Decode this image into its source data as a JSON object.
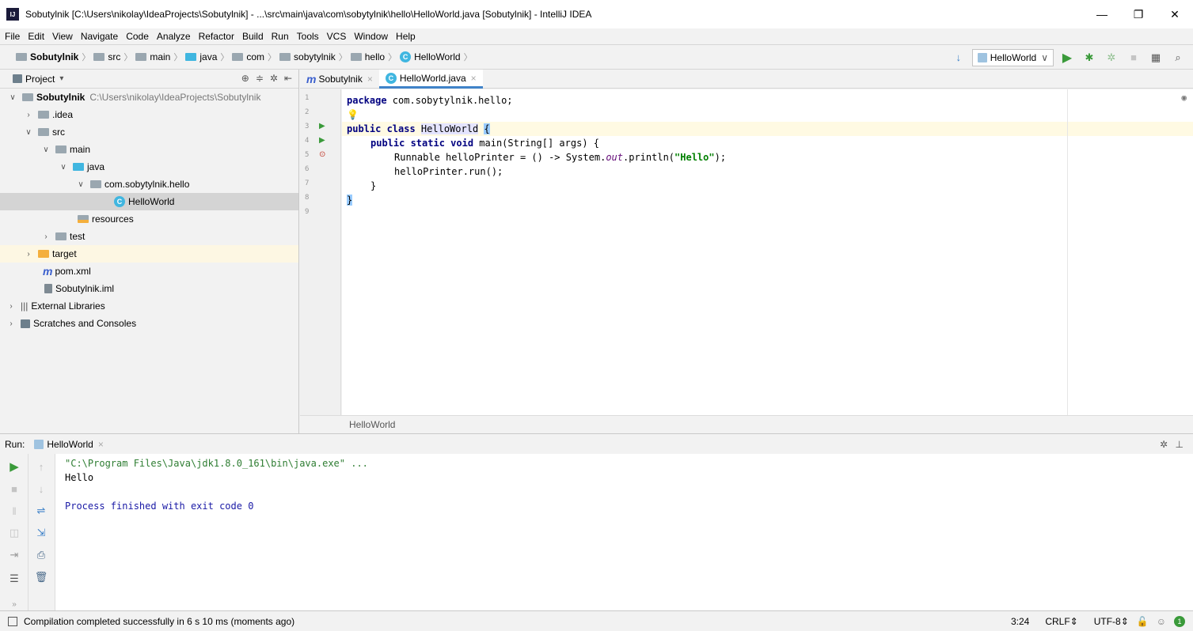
{
  "window": {
    "title": "Sobutylnik [C:\\Users\\nikolay\\IdeaProjects\\Sobutylnik] - ...\\src\\main\\java\\com\\sobytylnik\\hello\\HelloWorld.java [Sobutylnik] - IntelliJ IDEA",
    "app_icon_text": "IJ",
    "controls": {
      "minimize": "—",
      "restore": "❐",
      "close": "✕"
    }
  },
  "menu": [
    "File",
    "Edit",
    "View",
    "Navigate",
    "Code",
    "Analyze",
    "Refactor",
    "Build",
    "Run",
    "Tools",
    "VCS",
    "Window",
    "Help"
  ],
  "breadcrumb": [
    "Sobutylnik",
    "src",
    "main",
    "java",
    "com",
    "sobytylnik",
    "hello",
    "HelloWorld"
  ],
  "run_config": {
    "name": "HelloWorld",
    "chevron": "∨"
  },
  "project_panel": {
    "title": "Project",
    "dropdown": "▾",
    "tree": [
      {
        "label": "Sobutylnik",
        "hint": "C:\\Users\\nikolay\\IdeaProjects\\Sobutylnik"
      },
      {
        "label": ".idea"
      },
      {
        "label": "src"
      },
      {
        "label": "main"
      },
      {
        "label": "java"
      },
      {
        "label": "com.sobytylnik.hello"
      },
      {
        "label": "HelloWorld"
      },
      {
        "label": "resources"
      },
      {
        "label": "test"
      },
      {
        "label": "target"
      },
      {
        "label": "pom.xml"
      },
      {
        "label": "Sobutylnik.iml"
      },
      {
        "label": "External Libraries"
      },
      {
        "label": "Scratches and Consoles"
      }
    ]
  },
  "editor": {
    "tabs": [
      {
        "label": "Sobutylnik",
        "close": "×"
      },
      {
        "label": "HelloWorld.java",
        "close": "×"
      }
    ],
    "line_numbers": [
      "1",
      "2",
      "3",
      "4",
      "5",
      "6",
      "7",
      "8",
      "9"
    ],
    "code": {
      "line1_kw": "package",
      "line1_rest": " com.sobytylnik.hello;",
      "line3_kw": "public class ",
      "line3_name": "HelloWorld",
      "line3_brace": "{",
      "line4_kw": "public static void ",
      "line4_rest": "main(String[] args) {",
      "line5_a": "Runnable helloPrinter = () -> System.",
      "line5_field": "out",
      "line5_b": ".println(",
      "line5_str": "\"Hello\"",
      "line5_c": ");",
      "line6": "helloPrinter.run();",
      "line7": "}",
      "line8": "}"
    },
    "bottom_breadcrumb": "HelloWorld"
  },
  "run_panel": {
    "label": "Run:",
    "tab": "HelloWorld",
    "tab_close": "×",
    "console": [
      "\"C:\\Program Files\\Java\\jdk1.8.0_161\\bin\\java.exe\" ...",
      "Hello",
      "Process finished with exit code 0"
    ]
  },
  "status_bar": {
    "message": "Compilation completed successfully in 6 s 10 ms (moments ago)",
    "position": "3:24",
    "line_sep": "CRLF",
    "encoding": "UTF-8"
  },
  "colors": {
    "keyword": "#000080",
    "string": "#008000",
    "field": "#660e7a",
    "run_green": "#3a9a3a",
    "accent_blue": "#4083c9"
  }
}
